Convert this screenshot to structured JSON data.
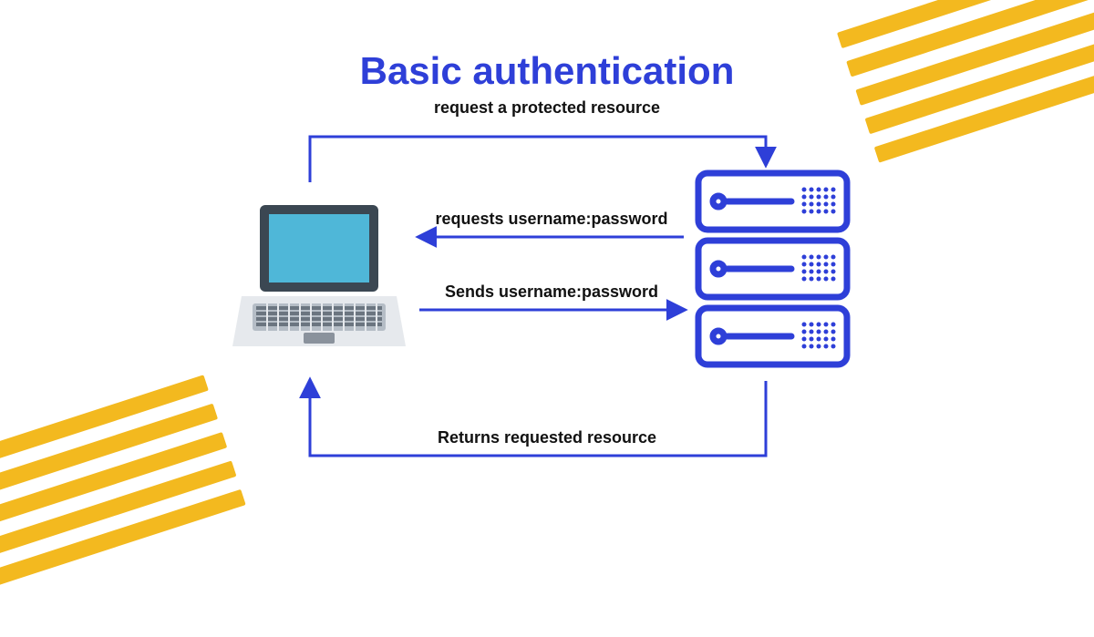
{
  "title": "Basic authentication",
  "labels": {
    "top": "request a protected resource",
    "mid1": "requests username:password",
    "mid2": "Sends username:password",
    "bottom": "Returns requested resource"
  },
  "nodes": {
    "client": "laptop",
    "server": "server"
  },
  "colors": {
    "accent": "#2E3FD8",
    "stripe": "#F3B91F"
  }
}
